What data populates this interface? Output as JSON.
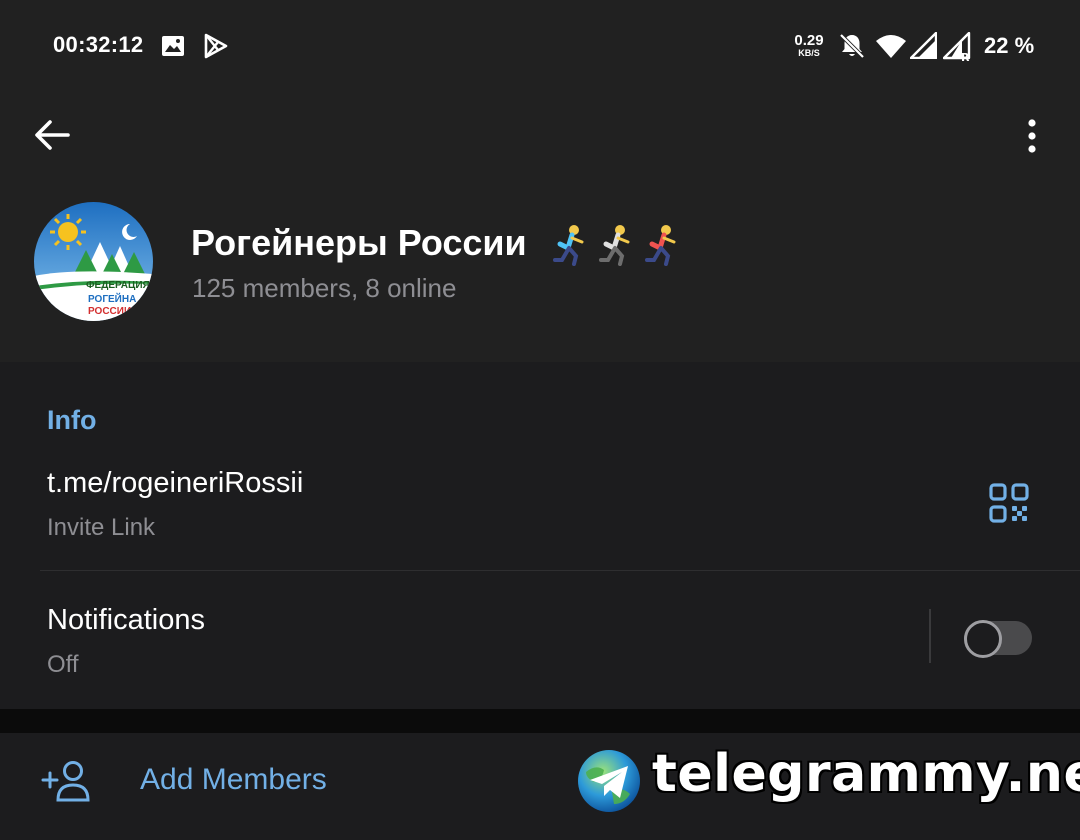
{
  "status_bar": {
    "time": "00:32:12",
    "net_speed_value": "0.29",
    "net_speed_unit": "KB/S",
    "battery": "22 %",
    "icons": [
      "image-icon",
      "play-store-icon",
      "bell-off-icon",
      "wifi-icon",
      "signal-icon",
      "signal-roaming-icon"
    ]
  },
  "header": {
    "title": "Рогейнеры России",
    "title_emoji_count": 3,
    "subtitle": "125 members, 8 online",
    "avatar_text_1": "ФЕДЕРАЦИЯ",
    "avatar_text_2": "РОГЕЙНА",
    "avatar_text_3": "РОССИИ"
  },
  "info": {
    "section_title": "Info",
    "link": "t.me/rogeineriRossii",
    "link_caption": "Invite Link",
    "notifications_title": "Notifications",
    "notifications_value": "Off",
    "notifications_enabled": false
  },
  "actions": {
    "add_members_label": "Add Members"
  },
  "watermark": {
    "text": "telegrammy.net"
  },
  "colors": {
    "background": "#212121",
    "section_background": "#1c1c1e",
    "accent": "#72b0e6",
    "secondary_text": "#8e8e93"
  }
}
